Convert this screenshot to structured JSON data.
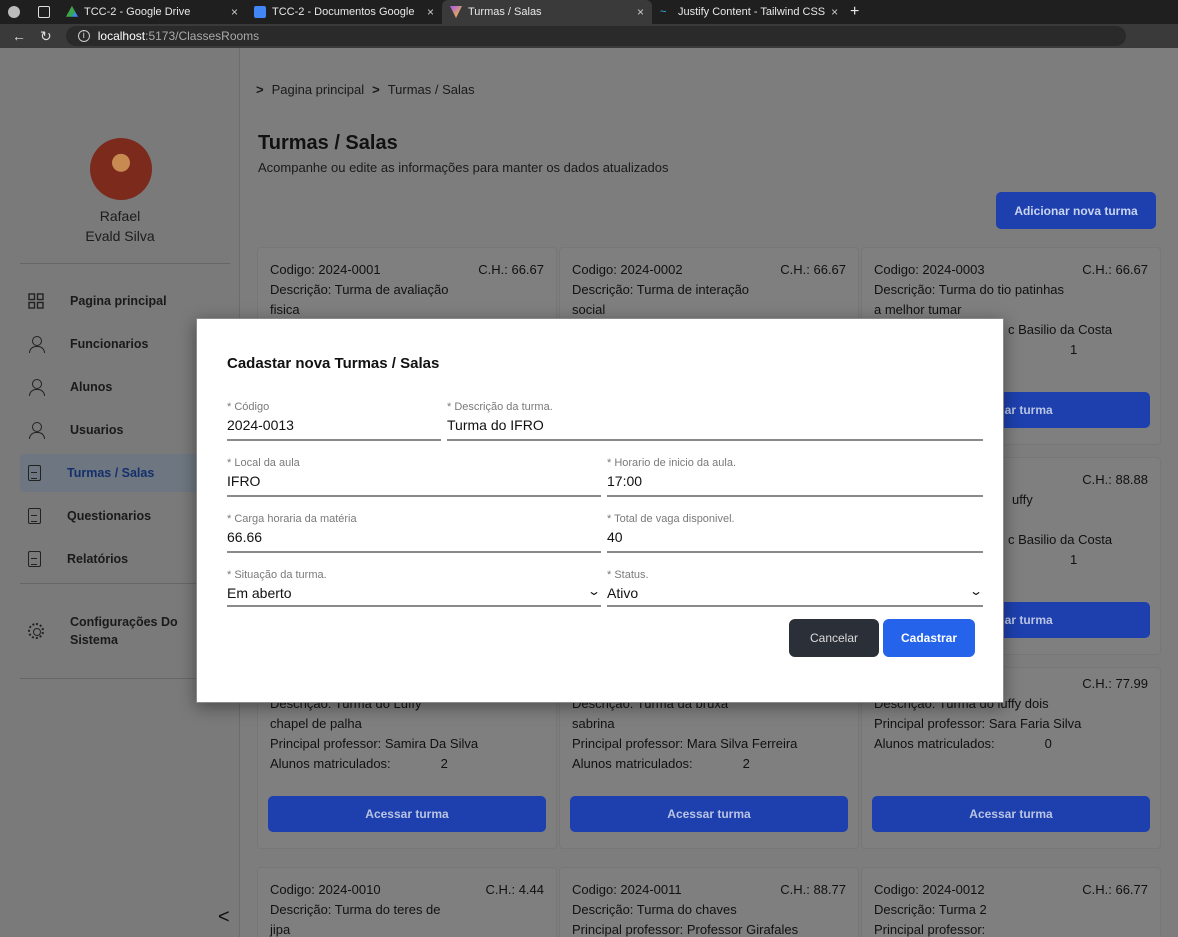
{
  "browser": {
    "tabs": [
      {
        "title": "TCC-2 - Google Drive"
      },
      {
        "title": "TCC-2 - Documentos Google"
      },
      {
        "title": "Turmas / Salas"
      },
      {
        "title": "Justify Content - Tailwind CSS"
      }
    ],
    "new_tab": "+",
    "close": "×",
    "url_host": "localhost",
    "url_path": ":5173/ClassesRooms"
  },
  "sidebar": {
    "user_first": "Rafael",
    "user_last": "Evald Silva",
    "items": [
      {
        "label": "Pagina principal",
        "icon": "grid-icon"
      },
      {
        "label": "Funcionarios",
        "icon": "user-icon"
      },
      {
        "label": "Alunos",
        "icon": "user-icon"
      },
      {
        "label": "Usuarios",
        "icon": "user-icon"
      },
      {
        "label": "Turmas / Salas",
        "icon": "document-icon"
      },
      {
        "label": "Questionarios",
        "icon": "document-icon"
      },
      {
        "label": "Relatórios",
        "icon": "document-icon"
      }
    ],
    "settings_line1": "Configurações Do",
    "settings_line2": "Sistema",
    "collapse": "<"
  },
  "main": {
    "breadcrumb": [
      "Pagina principal",
      "Turmas / Salas"
    ],
    "breadcrumb_sep": ">",
    "title": "Turmas / Salas",
    "subtitle": "Acompanhe ou edite as informações para manter os dados atualizados",
    "add_button": "Adicionar nova turma",
    "access_button": "Acessar turma",
    "cards_top": [
      {
        "code": "Codigo: 2024-0001",
        "ch": "C.H.: 66.67",
        "desc1": "Descrição: Turma de avaliação",
        "desc2": "fisica"
      },
      {
        "code": "Codigo: 2024-0002",
        "ch": "C.H.: 66.67",
        "desc1": "Descrição: Turma de interação",
        "desc2": "social"
      },
      {
        "code": "Codigo: 2024-0003",
        "ch": "C.H.: 66.67",
        "desc1": "Descrição: Turma do tio patinhas",
        "desc2": "a melhor tumar",
        "prof_tail": "c Basilio da Costa",
        "students": "1"
      }
    ],
    "card_mid_right": {
      "ch": "C.H.: 88.88",
      "desc_tail": "uffy",
      "prof_tail": "c Basilio da Costa",
      "students": "1"
    },
    "cards_row3": [
      {
        "desc1": "Descrição: Turma do Luffy",
        "desc2": "chapel de palha",
        "prof": "Principal professor: Samira Da Silva",
        "students_label": "Alunos matriculados:",
        "students": "2"
      },
      {
        "desc1": "Descrição: Turma da bruxa",
        "desc2": "sabrina",
        "prof": "Principal professor: Mara Silva Ferreira",
        "students_label": "Alunos matriculados:",
        "students": "2"
      },
      {
        "ch": "C.H.: 77.99",
        "desc1": "Descrição: Turma do luffy dois",
        "prof": "Principal professor: Sara Faria Silva",
        "students_label": "Alunos matriculados:",
        "students": "0"
      }
    ],
    "cards_bottom": [
      {
        "code": "Codigo: 2024-0010",
        "ch": "C.H.: 4.44",
        "desc1": "Descrição: Turma do teres de",
        "desc2": "jipa"
      },
      {
        "code": "Codigo: 2024-0011",
        "ch": "C.H.: 88.77",
        "desc1": "Descrição: Turma do chaves",
        "desc2": "Principal professor: Professor Girafales"
      },
      {
        "code": "Codigo: 2024-0012",
        "ch": "C.H.: 66.77",
        "desc1": "Descrição: Turma 2",
        "desc2": "Principal professor:"
      }
    ]
  },
  "modal": {
    "title": "Cadastar nova Turmas / Salas",
    "fields": {
      "codigo": {
        "label": "* Código",
        "value": "2024-0013"
      },
      "descricao": {
        "label": "* Descrição da turma.",
        "value": "Turma do IFRO"
      },
      "local": {
        "label": "* Local da aula",
        "value": "IFRO"
      },
      "horario": {
        "label": "* Horario de inicio da aula.",
        "value": "17:00"
      },
      "carga": {
        "label": "* Carga horaria da matéria",
        "value": "66.66"
      },
      "vagas": {
        "label": "* Total de vaga disponivel.",
        "value": "40"
      },
      "situacao": {
        "label": "* Situação da turma.",
        "value": "Em aberto"
      },
      "status": {
        "label": "* Status.",
        "value": "Ativo"
      }
    },
    "chevron": "⌄",
    "cancel": "Cancelar",
    "submit": "Cadastrar"
  },
  "colors": {
    "primary": "#1e40af",
    "submit": "#2563eb",
    "cancel": "#2b2f38"
  }
}
